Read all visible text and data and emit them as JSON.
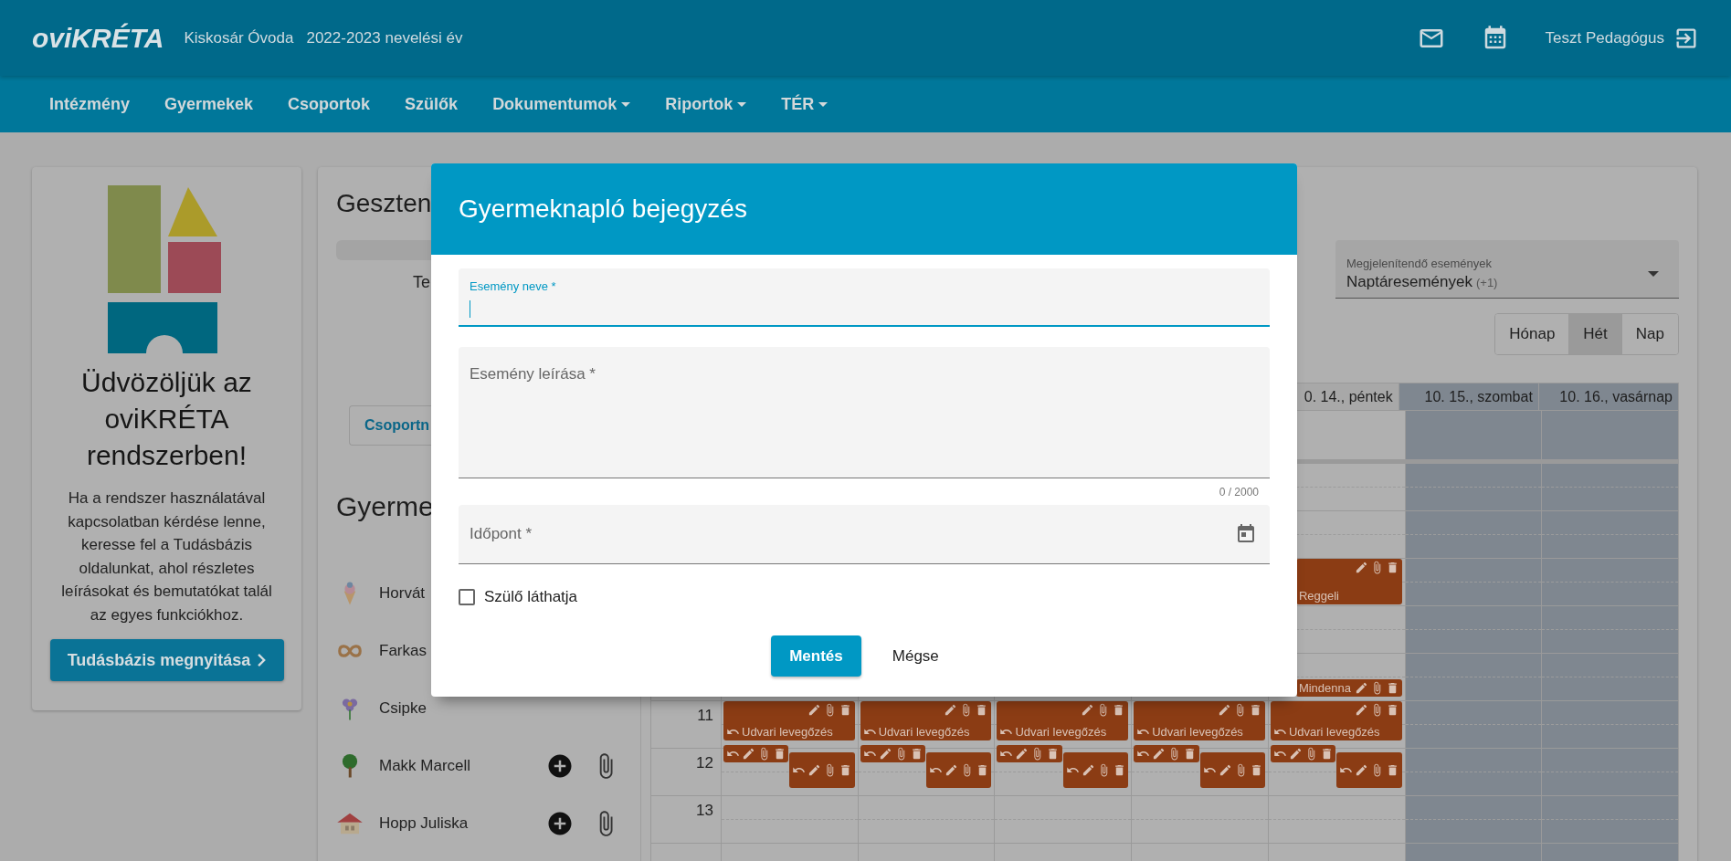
{
  "header": {
    "logo": "oviKRÉTA",
    "institution": "Kiskosár Óvoda",
    "school_year": "2022-2023 nevelési év",
    "user": "Teszt Pedagógus"
  },
  "nav": [
    {
      "label": "Intézmény",
      "dropdown": false
    },
    {
      "label": "Gyermekek",
      "dropdown": false
    },
    {
      "label": "Csoportok",
      "dropdown": false
    },
    {
      "label": "Szülők",
      "dropdown": false
    },
    {
      "label": "Dokumentumok",
      "dropdown": true
    },
    {
      "label": "Riportok",
      "dropdown": true
    },
    {
      "label": "TÉR",
      "dropdown": true
    }
  ],
  "welcome": {
    "title": "Üdvözöljük az oviKRÉTA rendszerben!",
    "text": "Ha a rendszer használatával kapcsolatban kérdése lenne, keresse fel a Tudásbázis oldalunkat, ahol részletes leírásokat és bemutatókat talál az egyes funkciókhoz.",
    "button": "Tudásbázis megnyitása"
  },
  "group_panel": {
    "title": "Geszten",
    "subtitle": "Te",
    "button": "Csoportn",
    "children_title": "Gyerme",
    "children": [
      {
        "name": "Horvát",
        "kind": "ice-cream",
        "actions": false
      },
      {
        "name": "Farkas",
        "kind": "pretzel",
        "actions": false
      },
      {
        "name": "Csipke",
        "kind": "flower",
        "actions": false
      },
      {
        "name": "Makk Marcell",
        "kind": "tree",
        "actions": true
      },
      {
        "name": "Hopp Juliska",
        "kind": "house",
        "actions": true
      }
    ]
  },
  "calendar": {
    "filter": {
      "label": "Megjelenítendő események",
      "value": "Naptáresemények",
      "extra": "(+1)"
    },
    "views": [
      {
        "label": "Hónap",
        "selected": false
      },
      {
        "label": "Hét",
        "selected": true
      },
      {
        "label": "Nap",
        "selected": false
      }
    ],
    "days": [
      {
        "weekend": false,
        "events": [
          {
            "kind": "outdoor",
            "title": "Udvari levegőzés",
            "repeat": true
          },
          {
            "kind": "chip-left",
            "repeat": true
          },
          {
            "kind": "chip-right",
            "repeat": true
          }
        ]
      },
      {
        "weekend": false,
        "events": [
          {
            "kind": "outdoor",
            "title": "Udvari levegőzés",
            "repeat": true
          },
          {
            "kind": "chip-left",
            "repeat": true
          },
          {
            "kind": "chip-right",
            "repeat": true
          }
        ]
      },
      {
        "weekend": false,
        "events": [
          {
            "kind": "outdoor",
            "title": "Udvari levegőzés",
            "repeat": true
          },
          {
            "kind": "chip-left",
            "repeat": true
          },
          {
            "kind": "chip-right",
            "repeat": true
          }
        ]
      },
      {
        "weekend": false,
        "events": [
          {
            "kind": "outdoor",
            "title": "Udvari levegőzés",
            "repeat": true
          },
          {
            "kind": "chip-left",
            "repeat": true
          },
          {
            "kind": "chip-right",
            "repeat": true
          }
        ]
      },
      {
        "label": "0. 14., péntek",
        "weekend": false,
        "events": [
          {
            "kind": "morning",
            "title": "Reggeli",
            "repeat": false
          },
          {
            "kind": "strip",
            "title": "Mindenna",
            "repeat": false
          },
          {
            "kind": "outdoor",
            "title": "Udvari levegőzés",
            "repeat": true
          },
          {
            "kind": "chip-left",
            "repeat": true
          },
          {
            "kind": "chip-right",
            "repeat": true
          }
        ]
      },
      {
        "label": "10. 15., szombat",
        "weekend": true
      },
      {
        "label": "10. 16., vasárnap",
        "weekend": true
      }
    ],
    "hours": [
      "11",
      "12",
      "13"
    ]
  },
  "dialog": {
    "title": "Gyermeknapló bejegyzés",
    "fields": [
      {
        "kind": "text",
        "label": "Esemény neve *",
        "focused": true
      },
      {
        "kind": "textarea",
        "label": "Esemény leírása *",
        "focused": false,
        "counter": "0 / 2000"
      },
      {
        "kind": "date",
        "label": "Időpont *",
        "focused": false
      }
    ],
    "checkbox": {
      "label": "Szülő láthatja",
      "checked": false
    },
    "buttons": [
      {
        "label": "Mentés",
        "kind": "primary"
      },
      {
        "label": "Mégse",
        "kind": "text"
      }
    ]
  }
}
